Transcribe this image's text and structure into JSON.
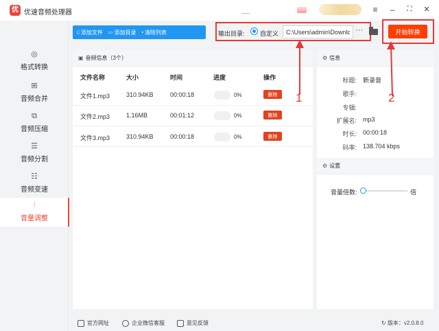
{
  "app": {
    "title": "优速音频处理器",
    "logo": "优"
  },
  "window": {
    "menu": "≡",
    "minimize": "–",
    "maximize": "⛶",
    "close": "✕"
  },
  "sidebar": {
    "items": [
      {
        "label": "格式转换",
        "icon": "format-convert-icon",
        "glyph": "◎"
      },
      {
        "label": "音频合并",
        "icon": "audio-merge-icon",
        "glyph": "⊞"
      },
      {
        "label": "音频压缩",
        "icon": "audio-compress-icon",
        "glyph": "⧉"
      },
      {
        "label": "音频分割",
        "icon": "audio-split-icon",
        "glyph": "☰"
      },
      {
        "label": "音频变速",
        "icon": "audio-speed-icon",
        "glyph": "☷"
      },
      {
        "label": "音量调整",
        "icon": "volume-adjust-icon",
        "glyph": "⫶",
        "active": true
      }
    ]
  },
  "toolbar": {
    "add_file": "添加文件",
    "add_dir": "添加目录",
    "clear_list": "清除列表"
  },
  "output": {
    "label": "输出目录:",
    "radio_label": "自定义",
    "path": "C:\\Users\\admin\\Downlc",
    "more": "···"
  },
  "start_button": "开始转换",
  "audio_panel": {
    "title": "音频信息（3个）",
    "columns": [
      "文件名称",
      "大小",
      "时间",
      "进度",
      "操作"
    ],
    "rows": [
      {
        "name": "文件1.mp3",
        "size": "310.94KB",
        "time": "00:00:18",
        "progress": "0%",
        "action": "删除"
      },
      {
        "name": "文件2.mp3",
        "size": "1.16MB",
        "time": "00:01:12",
        "progress": "0%",
        "action": "删除"
      },
      {
        "name": "文件3.mp3",
        "size": "310.94KB",
        "time": "00:00:18",
        "progress": "0%",
        "action": "删除"
      }
    ]
  },
  "info_panel": {
    "title": "信息",
    "fields": [
      {
        "key": "标题:",
        "value": "新录音"
      },
      {
        "key": "歌手:",
        "value": ""
      },
      {
        "key": "专辑:",
        "value": ""
      },
      {
        "key": "扩展名:",
        "value": "mp3"
      },
      {
        "key": "时长:",
        "value": "00:00:18"
      },
      {
        "key": "码率:",
        "value": "138.704 kbps"
      }
    ]
  },
  "settings_panel": {
    "title": "设置",
    "volume_label": "音量倍数:",
    "volume_unit": "倍",
    "volume_level": 0
  },
  "annotations": {
    "one": "1",
    "two": "2",
    "color": "#e53935"
  },
  "footer": {
    "website": "官方网址",
    "wechat": "企业微信客服",
    "feedback": "意见反馈",
    "version": "版本：v2.0.8.0"
  },
  "colors": {
    "accent": "#2196f3",
    "brand": "#e8483b",
    "start": "#ff3d00",
    "delete": "#e2421d"
  }
}
